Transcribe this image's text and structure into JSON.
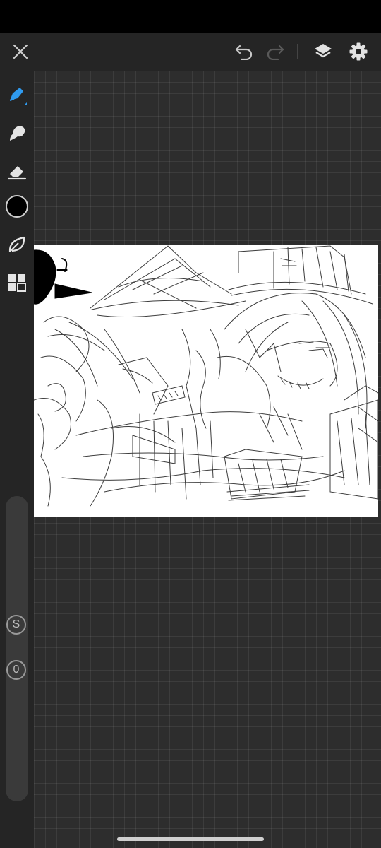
{
  "app": {
    "toolbar": {
      "close_icon": "close-icon",
      "undo_icon": "undo-icon",
      "redo_icon": "redo-icon",
      "layers_icon": "layers-icon",
      "settings_icon": "gear-icon"
    },
    "tools": [
      {
        "name": "brush-tool",
        "icon": "brush-icon",
        "active": true,
        "color": "#2f9bf0"
      },
      {
        "name": "smudge-tool",
        "icon": "smudge-icon",
        "active": false
      },
      {
        "name": "eraser-tool",
        "icon": "eraser-icon",
        "active": false
      },
      {
        "name": "color-swatch",
        "icon": "color-swatch-icon",
        "active": false,
        "color": "#000000"
      },
      {
        "name": "selection-tool",
        "icon": "lasso-leaf-icon",
        "active": false
      },
      {
        "name": "gallery-tool",
        "icon": "grid-icon",
        "active": false
      }
    ],
    "brush_size_badge": "S",
    "opacity_badge": "0",
    "colors": {
      "accent": "#2f9bf0",
      "topbar_bg": "#252525",
      "canvas_bg": "#2d2d2d",
      "artboard_bg": "#ffffff"
    }
  }
}
